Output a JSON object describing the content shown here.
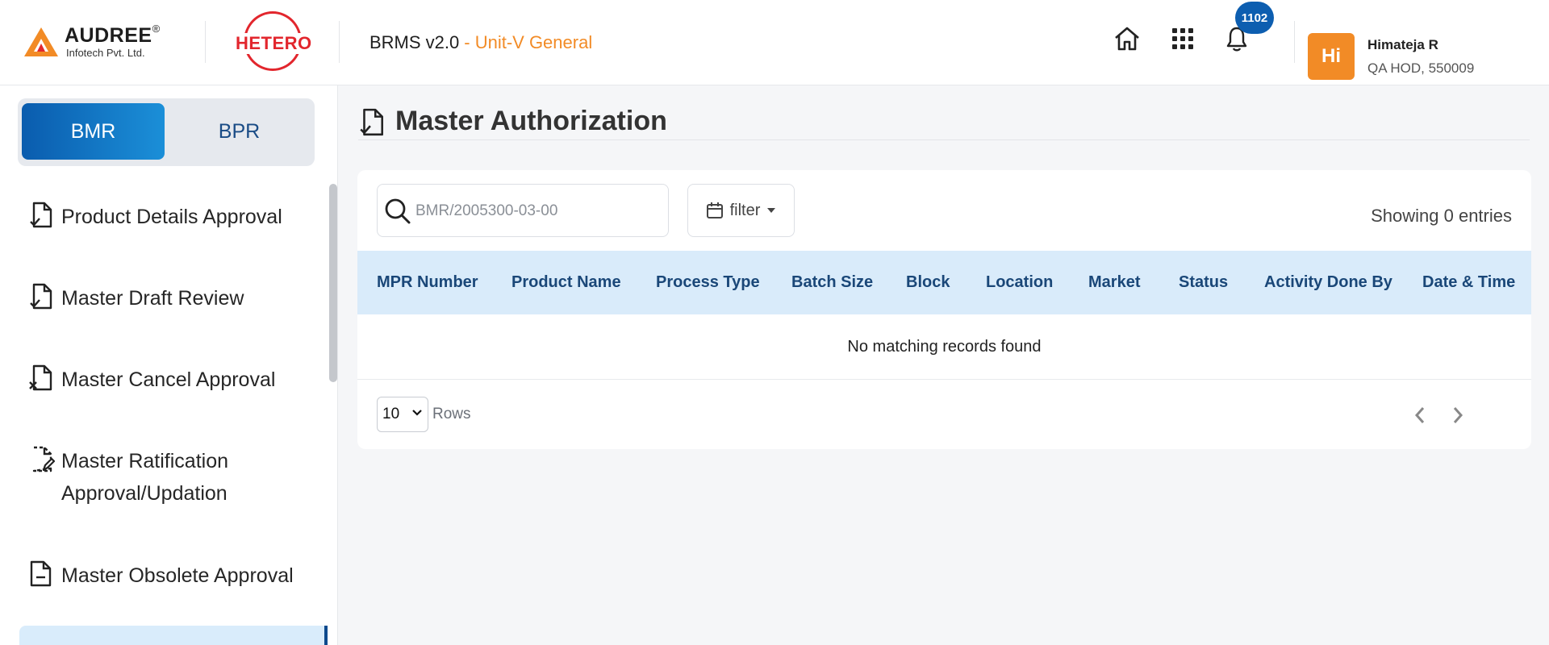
{
  "header": {
    "company_logo": {
      "brand": "AUDREE",
      "registered": "®",
      "subtitle": "Infotech Pvt. Ltd."
    },
    "client_logo": {
      "text": "HETERO"
    },
    "app_name": "BRMS v2.0",
    "unit_label": "- Unit-V General",
    "icons": [
      "home-icon",
      "apps-grid-icon",
      "bell-icon"
    ],
    "notification_count": "1102",
    "user": {
      "initials": "Hi",
      "name": "Himateja R",
      "role": "QA HOD, 550009"
    }
  },
  "sidebar": {
    "toggle": {
      "active": "BMR",
      "inactive": "BPR"
    },
    "items": [
      {
        "label": "Product Details Approval",
        "icon": "file-check-icon"
      },
      {
        "label": "Master Draft Review",
        "icon": "file-check-icon"
      },
      {
        "label": "Master Cancel Approval",
        "icon": "file-cancel-icon"
      },
      {
        "label": "Master Ratification Approval/Updation",
        "label_line1": "Master Ratification",
        "label_line2": "Approval/Updation",
        "icon": "file-edit-icon"
      },
      {
        "label": "Master Obsolete Approval",
        "icon": "file-minus-icon"
      }
    ]
  },
  "main": {
    "page_title": "Master Authorization",
    "search": {
      "placeholder": "BMR/2005300-03-00",
      "value": ""
    },
    "filter_label": "filter",
    "entries_text": "Showing 0 entries",
    "table": {
      "columns": [
        "MPR Number",
        "Product Name",
        "Process Type",
        "Batch Size",
        "Block",
        "Location",
        "Market",
        "Status",
        "Activity Done By",
        "Date & Time"
      ],
      "empty_message": "No matching records found"
    },
    "pagination": {
      "rows_value": "10",
      "rows_label": "Rows"
    }
  },
  "colors": {
    "brand_orange": "#f28b26",
    "primary_blue": "#0d5eb0",
    "header_row_bg": "#d9ebfa",
    "hetero_red": "#e2262d"
  }
}
